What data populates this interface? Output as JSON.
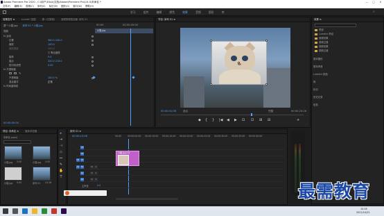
{
  "window": {
    "title": "Adobe Premiere Pro 2020 - C:\\用户\\Ellsiz\\文档\\Adobe\\Premiere Pro\\14.0\\未命名 *",
    "controls": [
      "—",
      "□",
      "✕"
    ]
  },
  "menu": [
    "文件(F)",
    "编辑(E)",
    "剪辑(C)",
    "序列(S)",
    "标记(M)",
    "图形(G)",
    "窗口(W)",
    "帮助(H)"
  ],
  "workspaces": [
    {
      "label": "学习",
      "active": false
    },
    {
      "label": "组件",
      "active": false
    },
    {
      "label": "编辑",
      "active": false
    },
    {
      "label": "颜色",
      "active": false
    },
    {
      "label": "效果",
      "active": true
    },
    {
      "label": "音频",
      "active": false
    },
    {
      "label": "图形",
      "active": false
    },
    {
      "label": "库",
      "active": false
    }
  ],
  "effect_controls": {
    "tabs": [
      "效果控件 ≡",
      "Lumetri 范围",
      "源: (无剪辑)",
      "音频剪辑混合器: 序列 01"
    ],
    "source": "源 * 小猫.jpg",
    "sequence": "序列 01 * 小猫.jpg",
    "timecode_in": "00:00",
    "timecode_out": "00:00:05:00",
    "clip_label": "小猫.jpg",
    "section_video": "视频",
    "rows": [
      {
        "label": "fx 运动",
        "value": ""
      },
      {
        "label": "位置",
        "value": "360.0  240.0"
      },
      {
        "label": "缩放",
        "value": "100.0"
      },
      {
        "label": "缩放宽度",
        "value": "100.0"
      },
      {
        "label": "",
        "value": "☑ 等比缩放"
      },
      {
        "label": "旋转",
        "value": "0.0"
      },
      {
        "label": "锚点",
        "value": "320.0  214.0"
      },
      {
        "label": "防闪烁滤镜",
        "value": "0.00"
      },
      {
        "label": "fx 不透明度",
        "value": ""
      },
      {
        "label": "不透明度",
        "value": "100.0 %"
      },
      {
        "label": "混合模式",
        "value": "正常"
      },
      {
        "label": "fx 时间重映射",
        "value": ""
      }
    ],
    "bottom_timecode": "00:00:00:00"
  },
  "program": {
    "tab": "节目: 序列 01 ≡",
    "timecode_left": "00:00:01:06",
    "fit": "适合",
    "quality": "完整",
    "timecode_right": "00:00:24:16",
    "controls": [
      "◆",
      "{",
      "}",
      "|◀",
      "◀",
      "▶",
      "▶|",
      "⊡",
      "⊞",
      "⊟",
      "+"
    ]
  },
  "project": {
    "tab": "项目: 未命名 ≡",
    "tab2": "媒体浏览器",
    "path": "未命名.prproj",
    "items": [
      {
        "label": "小猫.jpg",
        "duration": "5:00"
      },
      {
        "label": "小猫.jpg",
        "duration": "5:00"
      },
      {
        "label": "小猫.jpg",
        "duration": "5:00"
      },
      {
        "label": "序列 01",
        "duration": "24:16"
      }
    ]
  },
  "timeline": {
    "tab": "序列 01 ≡",
    "timecode": "00:00:13:06",
    "ruler": [
      "00:00",
      "00:00:05:00",
      "00:00:10:00",
      "00:00:15:00",
      "00:00:20:00",
      "00:00:25:00",
      "00:00:30:00",
      "00:00:35:00",
      "00:00:40:00"
    ],
    "tracks": [
      "V3",
      "V2",
      "V1",
      "A1",
      "A2",
      "A3",
      "主声道"
    ],
    "clip_name": "小猫.jpg [V]",
    "master_value": "0.0"
  },
  "effects_panel": {
    "title": "效果 ≡",
    "items": [
      "预设",
      "Lumetri 预设",
      "音频效果",
      "音频过渡",
      "视频效果",
      "视频过渡"
    ],
    "sections": [
      "基本图形",
      "基本声音",
      "Lumetri 颜色",
      "库",
      "标记",
      "历史记录",
      "信息"
    ]
  },
  "taskbar": {
    "time": "15:05",
    "date": "2021/10/22"
  },
  "watermark": "最需教育",
  "colors": {
    "accent": "#4fa3ff",
    "clip": "#c060c8",
    "panel": "#232323"
  }
}
